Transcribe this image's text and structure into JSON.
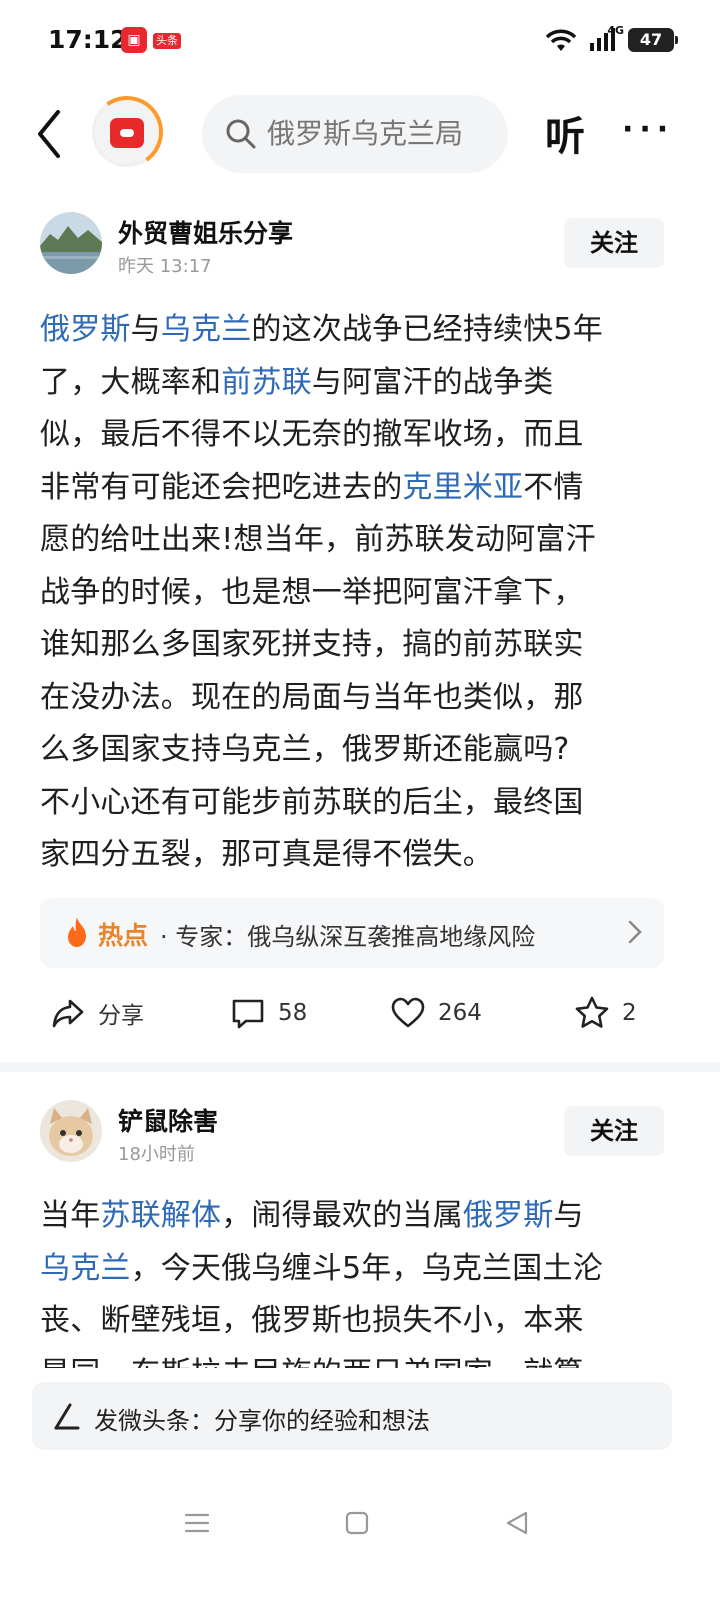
{
  "status_bar": {
    "time": "17:12",
    "app_badge": "头条",
    "network": "4G",
    "battery": "47"
  },
  "top_nav": {
    "search_text": "俄罗斯乌克兰局",
    "listen_label": "听",
    "more_label": "···"
  },
  "post1": {
    "author": "外贸曹姐乐分享",
    "time": "昨天  13:17",
    "follow_label": "关注",
    "lines": [
      [
        {
          "t": "俄罗斯",
          "k": true
        },
        {
          "t": "与"
        },
        {
          "t": "乌克兰",
          "k": true
        },
        {
          "t": "的这次战争已经持续快5年"
        }
      ],
      [
        {
          "t": "了，大概率和"
        },
        {
          "t": "前苏联",
          "k": true
        },
        {
          "t": "与阿富汗的战争类"
        }
      ],
      [
        {
          "t": "似，最后不得不以无奈的撤军收场，而且"
        }
      ],
      [
        {
          "t": "非常有可能还会把吃进去的"
        },
        {
          "t": "克里米亚",
          "k": true
        },
        {
          "t": "不情"
        }
      ],
      [
        {
          "t": "愿的给吐出来!想当年，前苏联发动阿富汗"
        }
      ],
      [
        {
          "t": "战争的时候，也是想一举把阿富汗拿下，"
        }
      ],
      [
        {
          "t": "谁知那么多国家死拼支持，搞的前苏联实"
        }
      ],
      [
        {
          "t": "在没办法。现在的局面与当年也类似，那"
        }
      ],
      [
        {
          "t": "么多国家支持乌克兰，俄罗斯还能赢吗?"
        }
      ],
      [
        {
          "t": "不小心还有可能步前苏联的后尘，最终国"
        }
      ],
      [
        {
          "t": "家四分五裂，那可真是得不偿失。"
        }
      ]
    ],
    "hot_label": "热点",
    "hot_text": "· 专家：俄乌纵深互袭推高地缘风险",
    "share_label": "分享",
    "comments": "58",
    "likes": "264",
    "favorites": "2"
  },
  "post2": {
    "author": "铲鼠除害",
    "time": "18小时前",
    "follow_label": "关注",
    "lines": [
      [
        {
          "t": "当年"
        },
        {
          "t": "苏联解体",
          "k": true
        },
        {
          "t": "，闹得最欢的当属"
        },
        {
          "t": "俄罗斯",
          "k": true
        },
        {
          "t": "与"
        }
      ],
      [
        {
          "t": "乌克兰",
          "k": true
        },
        {
          "t": "，今天俄乌缠斗5年，乌克兰国土沦"
        }
      ],
      [
        {
          "t": "丧、断壁残垣，俄罗斯也损失不小，本来"
        }
      ],
      [
        {
          "t": "是同一东斯拉夫民族的两兄弟国家，就算"
        }
      ]
    ]
  },
  "compose": {
    "placeholder": "发微头条：分享你的经验和想法"
  },
  "colors": {
    "keyword": "#2f6ab7",
    "hot": "#e8842a"
  }
}
